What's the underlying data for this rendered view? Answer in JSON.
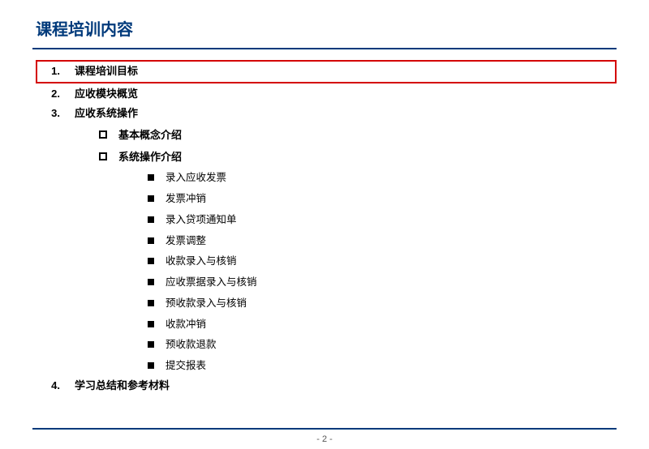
{
  "title": "课程培训内容",
  "toc": {
    "item1": {
      "num": "1.",
      "label": "课程培训目标"
    },
    "item2": {
      "num": "2.",
      "label": "应收模块概览"
    },
    "item3": {
      "num": "3.",
      "label": "应收系统操作"
    },
    "sub3a": {
      "label": "基本概念介绍"
    },
    "sub3b": {
      "label": "系统操作介绍"
    },
    "leaf1": "录入应收发票",
    "leaf2": "发票冲销",
    "leaf3": "录入贷项通知单",
    "leaf4": "发票调整",
    "leaf5": "收款录入与核销",
    "leaf6": "应收票据录入与核销",
    "leaf7": "预收款录入与核销",
    "leaf8": "收款冲销",
    "leaf9": "预收款退款",
    "leaf10": "提交报表",
    "item4": {
      "num": "4.",
      "label": "学习总结和参考材料"
    }
  },
  "page_number": "-  2  -"
}
